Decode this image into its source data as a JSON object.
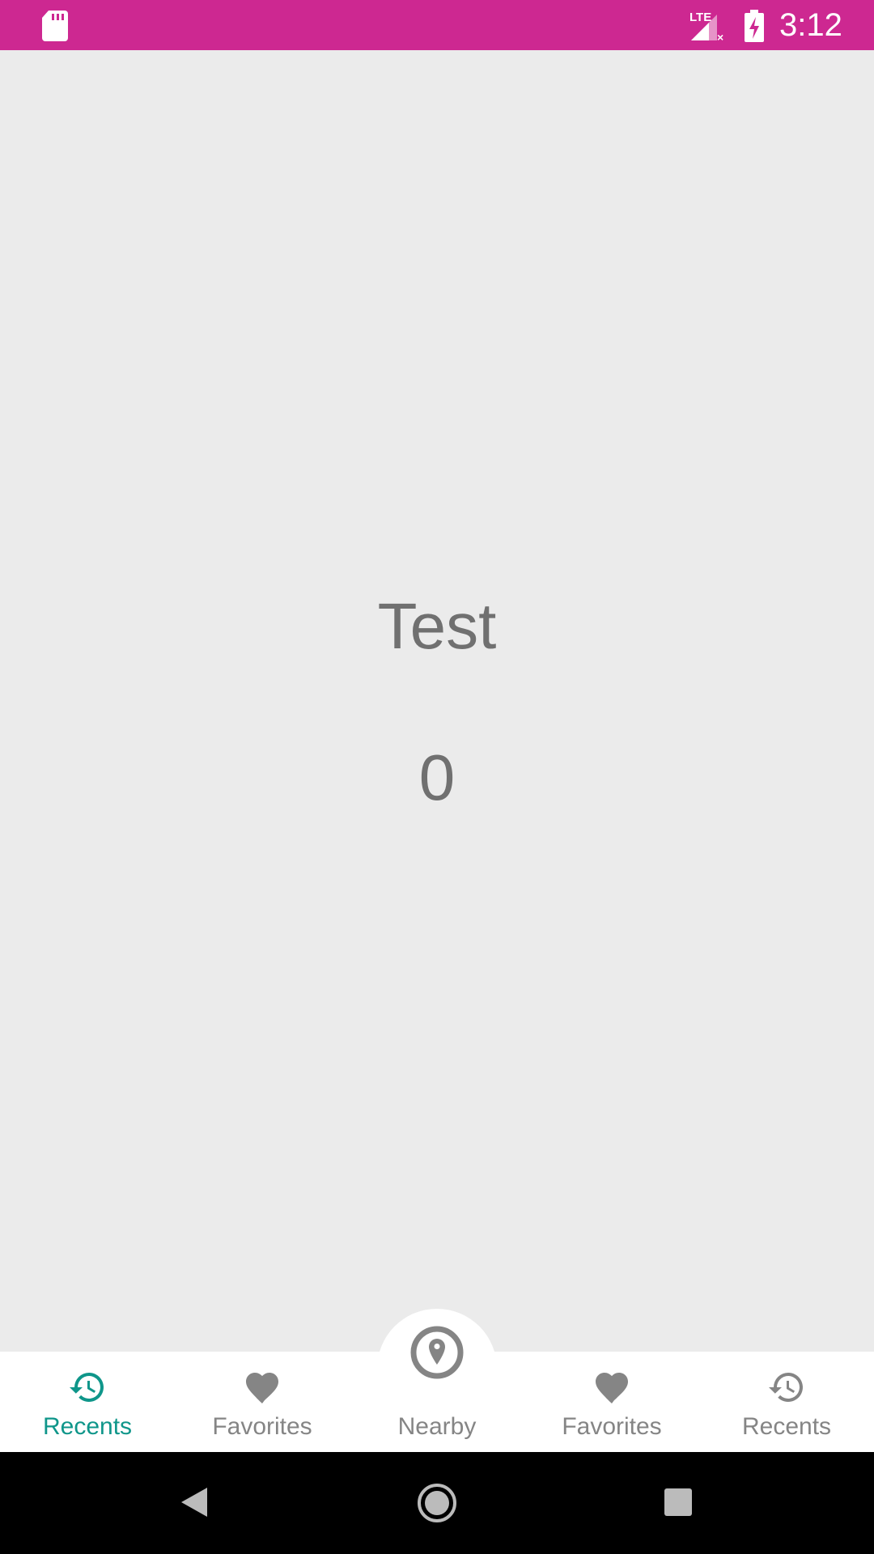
{
  "status_bar": {
    "time": "3:12",
    "network": "LTE",
    "icons": [
      "sd-card-icon",
      "lte-signal-icon",
      "battery-charging-icon"
    ],
    "color": "#cd2891"
  },
  "main": {
    "title": "Test",
    "count": "0"
  },
  "bottom_nav": {
    "accent": "#0f968a",
    "items": [
      {
        "label": "Recents",
        "icon": "history-icon",
        "active": true
      },
      {
        "label": "Favorites",
        "icon": "heart-icon"
      },
      {
        "label": "Nearby",
        "icon": "location-pin-icon"
      },
      {
        "label": "Favorites",
        "icon": "heart-icon"
      },
      {
        "label": "Recents",
        "icon": "history-icon"
      }
    ]
  },
  "system_nav": {
    "icons": [
      "back-icon",
      "home-icon",
      "recents-square-icon"
    ]
  }
}
